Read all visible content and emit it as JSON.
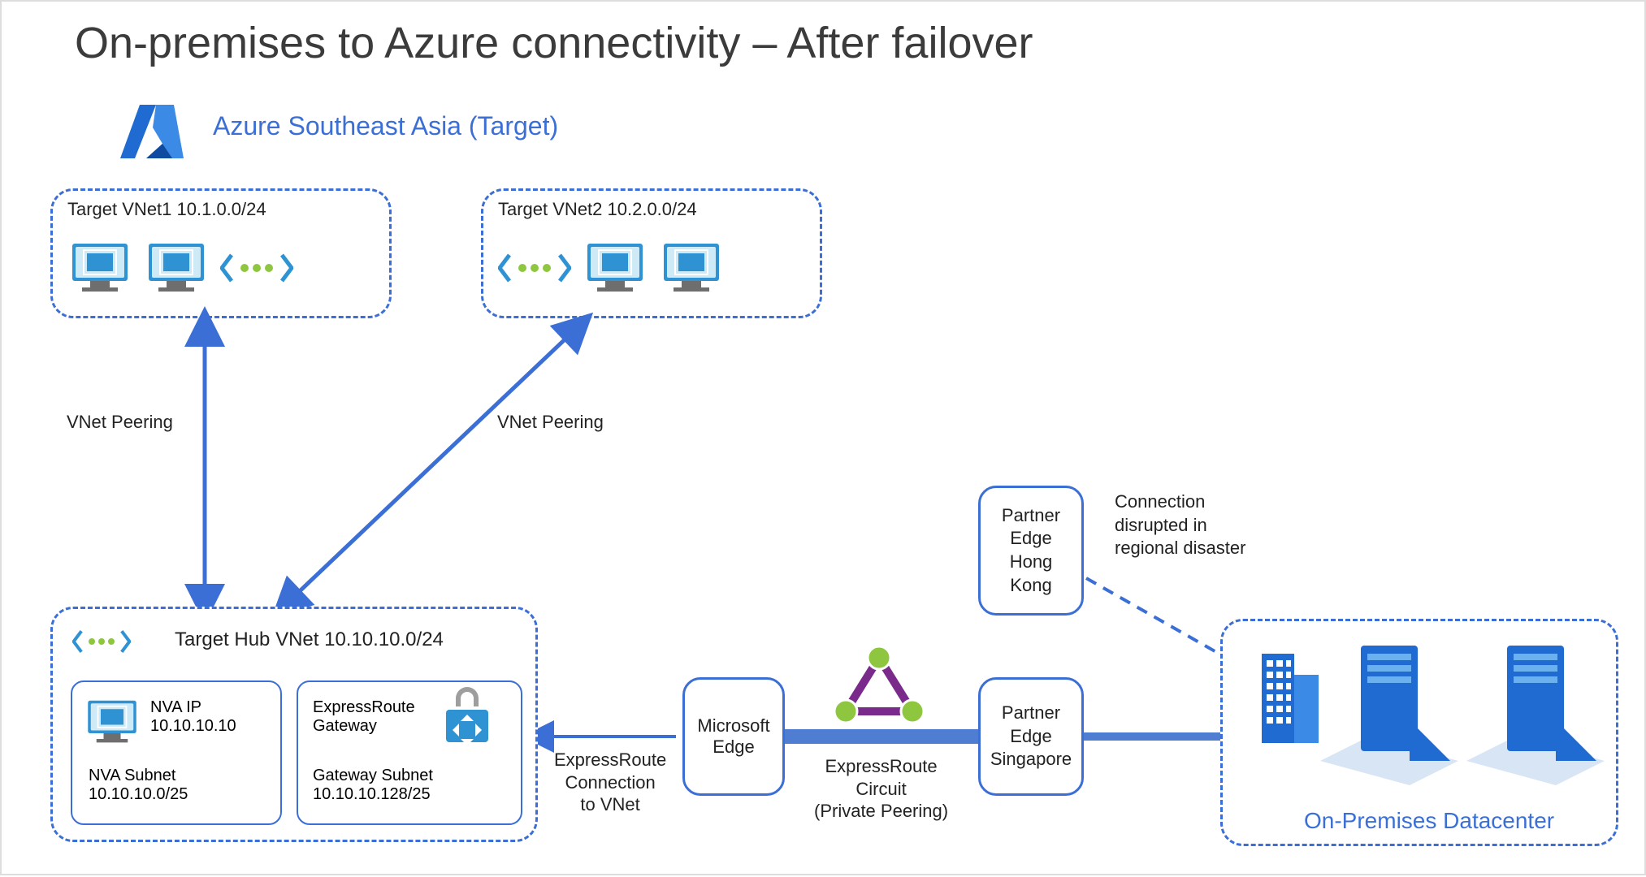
{
  "title": "On-premises to Azure connectivity – After failover",
  "region": "Azure Southeast Asia (Target)",
  "vnet1": "Target VNet1 10.1.0.0/24",
  "vnet2": "Target VNet2 10.2.0.0/24",
  "hub": "Target Hub VNet 10.10.10.0/24",
  "peering": "VNet Peering",
  "nva_ip_l1": "NVA IP",
  "nva_ip_l2": "10.10.10.10",
  "nva_subnet_l1": "NVA Subnet",
  "nva_subnet_l2": "10.10.10.0/25",
  "er_gw_l1": "ExpressRoute",
  "er_gw_l2": "Gateway",
  "gw_subnet_l1": "Gateway Subnet",
  "gw_subnet_l2": "10.10.10.128/25",
  "er_conn_l1": "ExpressRoute",
  "er_conn_l2": "Connection",
  "er_conn_l3": "to VNet",
  "ms_edge_l1": "Microsoft",
  "ms_edge_l2": "Edge",
  "er_circuit_l1": "ExpressRoute",
  "er_circuit_l2": "Circuit",
  "er_circuit_l3": "(Private Peering)",
  "pe_hk_l1": "Partner",
  "pe_hk_l2": "Edge",
  "pe_hk_l3": "Hong",
  "pe_hk_l4": "Kong",
  "pe_sg_l1": "Partner",
  "pe_sg_l2": "Edge",
  "pe_sg_l3": "Singapore",
  "disrupt_l1": "Connection",
  "disrupt_l2": "disrupted in",
  "disrupt_l3": "regional disaster",
  "dc": "On-Premises Datacenter"
}
